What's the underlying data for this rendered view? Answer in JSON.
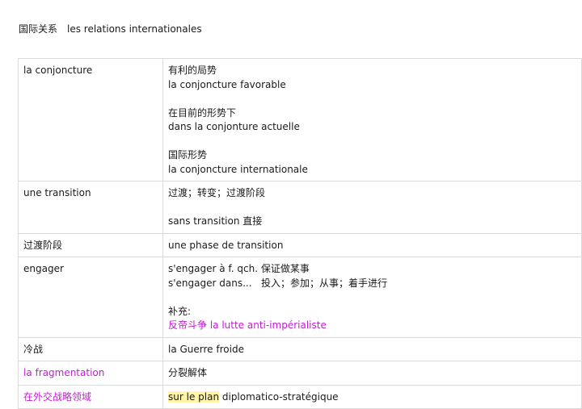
{
  "title": {
    "zh": "国际关系",
    "fr": "les relations internationales"
  },
  "colors": {
    "accent_magenta": "#c41bd6",
    "highlight_yellow": "#fff4a8",
    "border": "#d9d9d9"
  },
  "rows": [
    {
      "term": "la conjoncture",
      "lines": [
        "有利的局势",
        "la conjoncture favorable",
        "",
        "在目前的形势下",
        "dans la conjonture actuelle",
        "",
        "国际形势",
        "la conjoncture internationale"
      ]
    },
    {
      "term": "une transition",
      "lines": [
        "过渡；转变；过渡阶段",
        "",
        "sans transition 直接"
      ]
    },
    {
      "term": "过渡阶段",
      "lines": [
        "une phase de transition"
      ]
    },
    {
      "term": "engager",
      "lines": [
        "s'engager à f. qch. 保证做某事",
        "s'engager dans...   投入；参加；从事；着手进行",
        "",
        "补充:",
        "反帝斗争 la lutte anti-impérialiste"
      ]
    },
    {
      "term": "冷战",
      "lines": [
        "la Guerre froide"
      ]
    },
    {
      "term": "la fragmentation",
      "lines": [
        "分裂解体"
      ]
    },
    {
      "term": "在外交战略领域",
      "def_highlight": "sur le plan",
      "def_rest": " diplomatico-stratégique"
    }
  ]
}
